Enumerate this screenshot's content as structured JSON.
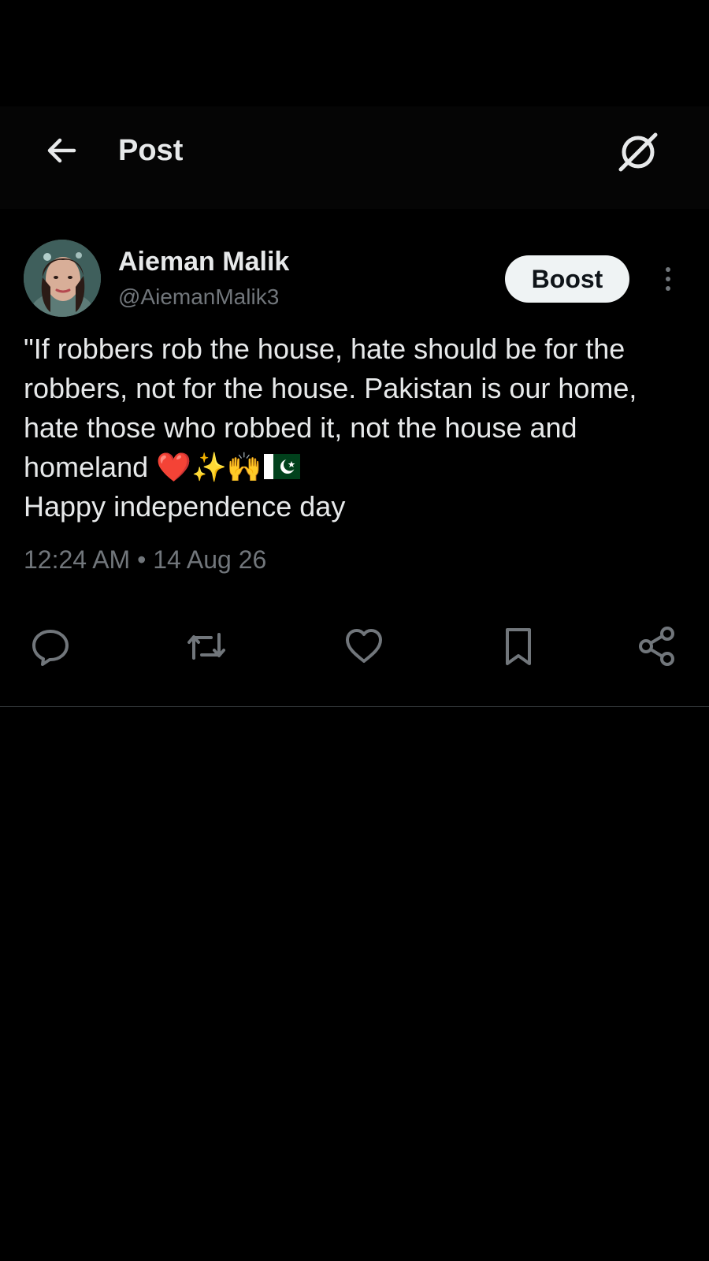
{
  "header": {
    "title": "Post",
    "back_icon": "arrow-left-icon",
    "grok_icon": "grok-icon"
  },
  "post": {
    "author": {
      "name": "Aieman Malik",
      "handle": "@AiemanMalik3"
    },
    "boost_label": "Boost",
    "text_lines": [
      "\"If robbers rob the house, hate should be for the robbers, not for the house. Pakistan is our home, hate those who robbed it, not the house and homeland ❤️✨🙌",
      "Happy independence day"
    ],
    "flag_emoji": "🇵🇰",
    "timestamp": "12:24 AM • 14 Aug 26"
  },
  "actions": {
    "reply_icon": "reply-icon",
    "repost_icon": "repost-icon",
    "like_icon": "heart-icon",
    "bookmark_icon": "bookmark-icon",
    "share_icon": "share-icon"
  },
  "colors": {
    "background": "#000000",
    "text_primary": "#e7e9ea",
    "text_secondary": "#71767b",
    "button_bg": "#eff3f4"
  }
}
